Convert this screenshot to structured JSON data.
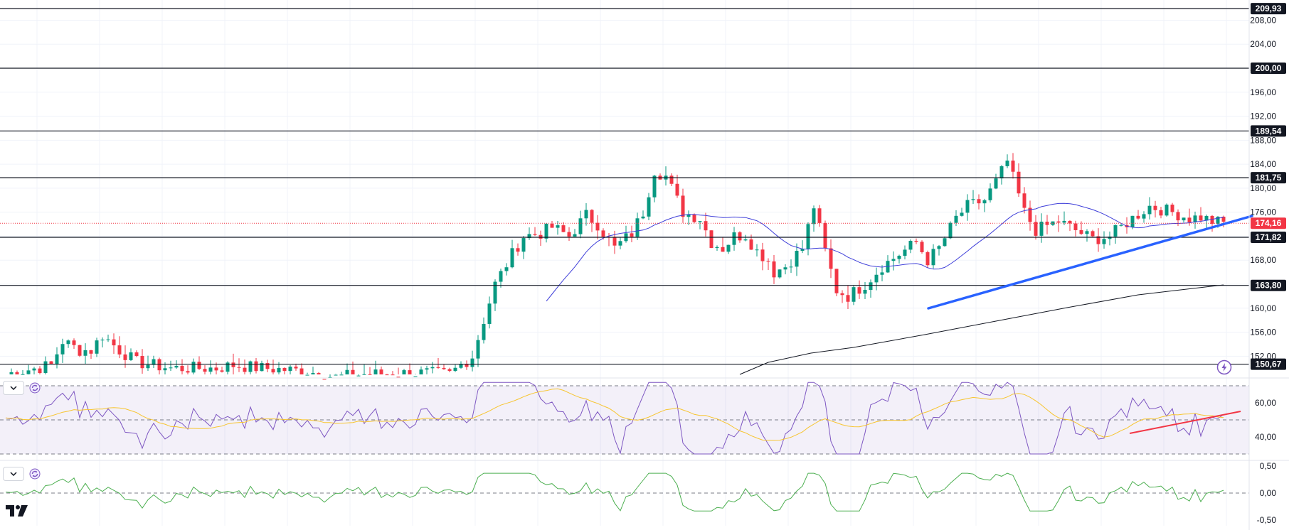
{
  "chart_data": {
    "type": "candlestick",
    "price_axis_labels": [
      "208,00",
      "204,00",
      "200,00",
      "196,00",
      "192,00",
      "188,00",
      "184,00",
      "180,00",
      "176,00",
      "172,00",
      "168,00",
      "164,00",
      "160,00",
      "156,00",
      "152,00"
    ],
    "price_axis_values": [
      208,
      204,
      200,
      196,
      192,
      188,
      184,
      180,
      176,
      172,
      168,
      164,
      160,
      156,
      152
    ],
    "ylim": [
      149.5,
      211
    ],
    "horizontal_levels": [
      {
        "value": 209.93,
        "label": "209,93"
      },
      {
        "value": 200.0,
        "label": "200,00"
      },
      {
        "value": 189.54,
        "label": "189,54"
      },
      {
        "value": 181.75,
        "label": "181,75"
      },
      {
        "value": 171.82,
        "label": "171,82"
      },
      {
        "value": 163.8,
        "label": "163,80"
      },
      {
        "value": 150.67,
        "label": "150,67"
      }
    ],
    "last_price": {
      "value": 174.16,
      "label": "174,16",
      "color": "#f23645"
    },
    "colors": {
      "up": "#089981",
      "down": "#f23645",
      "ma_short": "#3f3fd9",
      "ma_long": "#131722",
      "trendline": "#2962ff",
      "rsi": "#7e57c2",
      "rsi_ma": "#f7c52f",
      "rsi_trend": "#f23645",
      "third": "#4caf50"
    },
    "rsi": {
      "axis_labels": [
        "60,00",
        "40,00"
      ],
      "axis_values": [
        60,
        40
      ],
      "upper": 70,
      "middle": 50,
      "lower": 30,
      "ylim": [
        28,
        72
      ]
    },
    "third_panel": {
      "axis_labels": [
        "0,50",
        "0,00",
        "-0,50"
      ],
      "axis_values": [
        0.5,
        0,
        -0.5
      ],
      "ylim": [
        -0.55,
        0.55
      ]
    },
    "logo": "tradingview-logo",
    "icons": [
      "chevron-down-icon",
      "sync-icon",
      "lightning-icon"
    ]
  }
}
